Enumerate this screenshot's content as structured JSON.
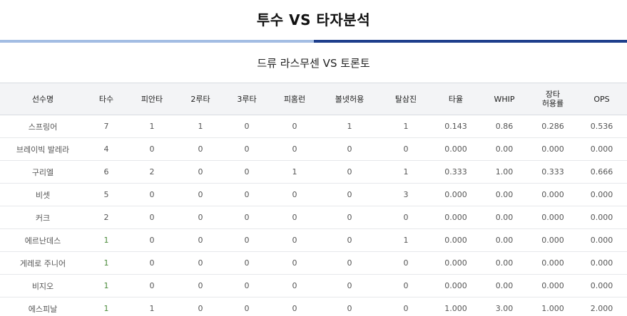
{
  "title": "투수 VS 타자분석",
  "subtitle": "드류 라스무센 VS 토론토",
  "columns": [
    "선수명",
    "타수",
    "피안타",
    "2루타",
    "3루타",
    "피홈런",
    "볼넷허용",
    "탈삼진",
    "타율",
    "WHIP",
    "장타\n허용률",
    "OPS"
  ],
  "rows": [
    [
      "스프링어",
      "7",
      "1",
      "1",
      "0",
      "0",
      "1",
      "1",
      "0.143",
      "0.86",
      "0.286",
      "0.536"
    ],
    [
      "브레이빅 발레라",
      "4",
      "0",
      "0",
      "0",
      "0",
      "0",
      "0",
      "0.000",
      "0.00",
      "0.000",
      "0.000"
    ],
    [
      "구리엘",
      "6",
      "2",
      "0",
      "0",
      "1",
      "0",
      "1",
      "0.333",
      "1.00",
      "0.333",
      "0.666"
    ],
    [
      "비셋",
      "5",
      "0",
      "0",
      "0",
      "0",
      "0",
      "3",
      "0.000",
      "0.00",
      "0.000",
      "0.000"
    ],
    [
      "커크",
      "2",
      "0",
      "0",
      "0",
      "0",
      "0",
      "0",
      "0.000",
      "0.00",
      "0.000",
      "0.000"
    ],
    [
      "에르난데스",
      "1",
      "0",
      "0",
      "0",
      "0",
      "0",
      "1",
      "0.000",
      "0.00",
      "0.000",
      "0.000"
    ],
    [
      "게레로 주니어",
      "1",
      "0",
      "0",
      "0",
      "0",
      "0",
      "0",
      "0.000",
      "0.00",
      "0.000",
      "0.000"
    ],
    [
      "비지오",
      "1",
      "0",
      "0",
      "0",
      "0",
      "0",
      "0",
      "0.000",
      "0.00",
      "0.000",
      "0.000"
    ],
    [
      "에스피날",
      "1",
      "1",
      "0",
      "0",
      "0",
      "0",
      "0",
      "1.000",
      "3.00",
      "1.000",
      "2.000"
    ]
  ],
  "colors": {
    "rule_light": "#a3bde3",
    "rule_dark": "#1e3f8c",
    "header_bg": "#f3f4f6",
    "highlight_green": "#4a8a3a"
  }
}
